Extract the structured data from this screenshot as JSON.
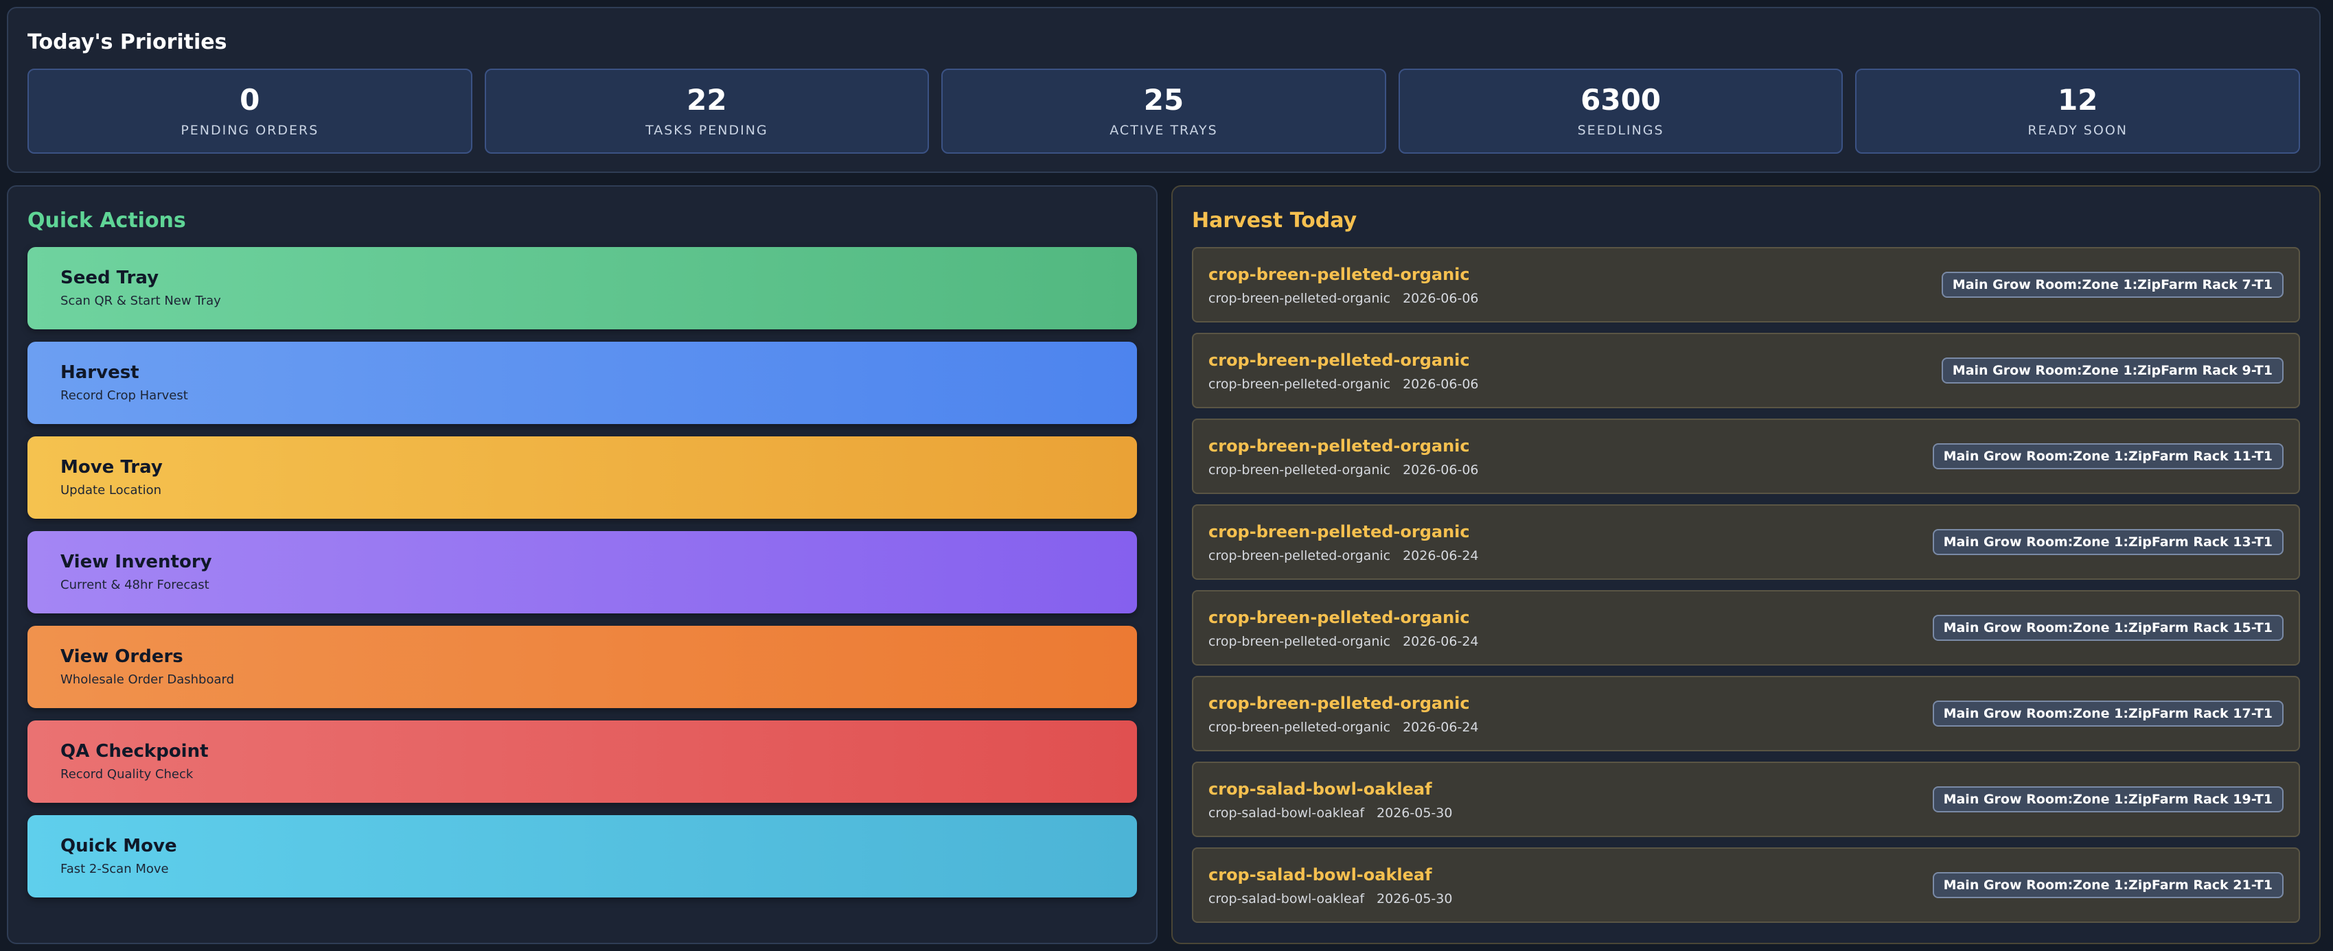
{
  "priorities": {
    "title": "Today's Priorities",
    "stats": [
      {
        "value": "0",
        "label": "PENDING ORDERS"
      },
      {
        "value": "22",
        "label": "TASKS PENDING"
      },
      {
        "value": "25",
        "label": "ACTIVE TRAYS"
      },
      {
        "value": "6300",
        "label": "SEEDLINGS"
      },
      {
        "value": "12",
        "label": "READY SOON"
      }
    ]
  },
  "quick_actions": {
    "title": "Quick Actions",
    "items": [
      {
        "title": "Seed Tray",
        "subtitle": "Scan QR & Start New Tray",
        "color": "#5fc58f"
      },
      {
        "title": "Harvest",
        "subtitle": "Record Crop Harvest",
        "color": "#5a8ff0"
      },
      {
        "title": "Move Tray",
        "subtitle": "Update Location",
        "color": "#f0b443"
      },
      {
        "title": "View Inventory",
        "subtitle": "Current & 48hr Forecast",
        "color": "#9470f1"
      },
      {
        "title": "View Orders",
        "subtitle": "Wholesale Order Dashboard",
        "color": "#ee8540"
      },
      {
        "title": "QA Checkpoint",
        "subtitle": "Record Quality Check",
        "color": "#e46060"
      },
      {
        "title": "Quick Move",
        "subtitle": "Fast 2-Scan Move",
        "color": "#56c1e1"
      }
    ]
  },
  "harvest_today": {
    "title": "Harvest Today",
    "items": [
      {
        "crop": "crop-breen-pelleted-organic",
        "sub": "crop-breen-pelleted-organic",
        "date": "2026-06-06",
        "location": "Main Grow Room:Zone 1:ZipFarm Rack 7-T1"
      },
      {
        "crop": "crop-breen-pelleted-organic",
        "sub": "crop-breen-pelleted-organic",
        "date": "2026-06-06",
        "location": "Main Grow Room:Zone 1:ZipFarm Rack 9-T1"
      },
      {
        "crop": "crop-breen-pelleted-organic",
        "sub": "crop-breen-pelleted-organic",
        "date": "2026-06-06",
        "location": "Main Grow Room:Zone 1:ZipFarm Rack 11-T1"
      },
      {
        "crop": "crop-breen-pelleted-organic",
        "sub": "crop-breen-pelleted-organic",
        "date": "2026-06-24",
        "location": "Main Grow Room:Zone 1:ZipFarm Rack 13-T1"
      },
      {
        "crop": "crop-breen-pelleted-organic",
        "sub": "crop-breen-pelleted-organic",
        "date": "2026-06-24",
        "location": "Main Grow Room:Zone 1:ZipFarm Rack 15-T1"
      },
      {
        "crop": "crop-breen-pelleted-organic",
        "sub": "crop-breen-pelleted-organic",
        "date": "2026-06-24",
        "location": "Main Grow Room:Zone 1:ZipFarm Rack 17-T1"
      },
      {
        "crop": "crop-salad-bowl-oakleaf",
        "sub": "crop-salad-bowl-oakleaf",
        "date": "2026-05-30",
        "location": "Main Grow Room:Zone 1:ZipFarm Rack 19-T1"
      },
      {
        "crop": "crop-salad-bowl-oakleaf",
        "sub": "crop-salad-bowl-oakleaf",
        "date": "2026-05-30",
        "location": "Main Grow Room:Zone 1:ZipFarm Rack 21-T1"
      }
    ]
  }
}
